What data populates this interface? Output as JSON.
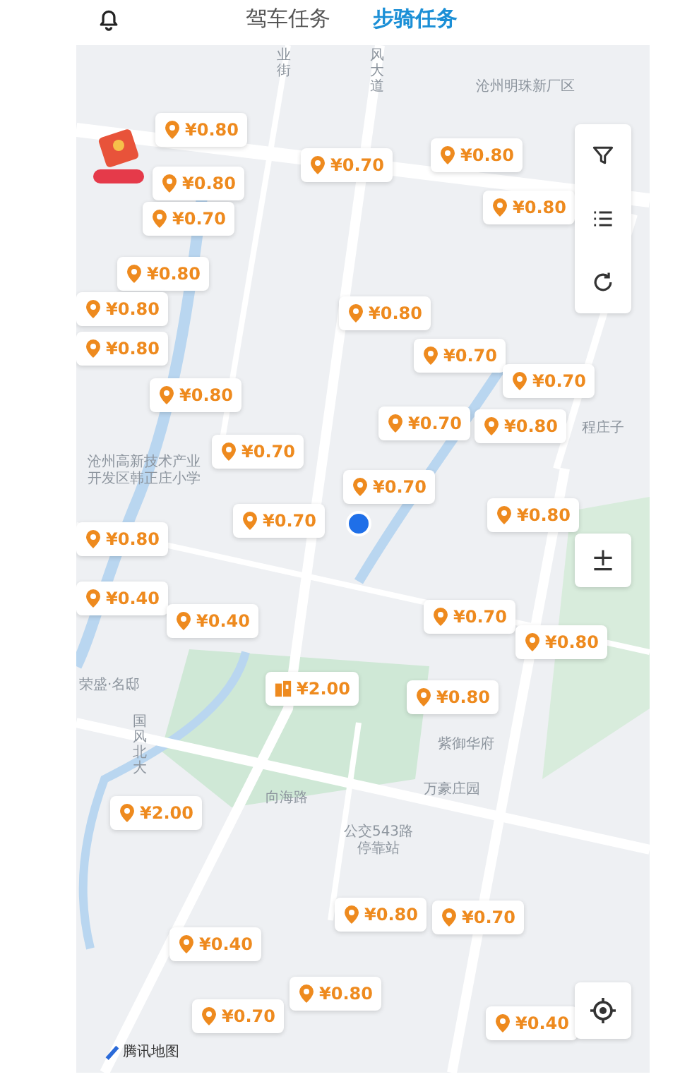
{
  "header": {
    "tabs": [
      {
        "label": "驾车任务",
        "selected": false
      },
      {
        "label": "步骑任务",
        "selected": true
      }
    ]
  },
  "map": {
    "labels": [
      {
        "text": "业街",
        "kind": "vertical"
      },
      {
        "text": "风大道",
        "kind": "vertical"
      },
      {
        "text": "沧州明珠新厂区",
        "kind": "place"
      },
      {
        "text": "沧州高新技术产业开发区韩正庄小学",
        "kind": "place"
      },
      {
        "text": "程庄子",
        "kind": "place"
      },
      {
        "text": "荣盛·名邸",
        "kind": "place"
      },
      {
        "text": "国风北大",
        "kind": "vertical"
      },
      {
        "text": "向海路",
        "kind": "road"
      },
      {
        "text": "紫御华府",
        "kind": "place"
      },
      {
        "text": "万豪庄园",
        "kind": "place"
      },
      {
        "text": "公交543路停靠站",
        "kind": "stop"
      }
    ],
    "markers": [
      {
        "price": "¥0.80",
        "kind": "pin"
      },
      {
        "price": "¥0.70",
        "kind": "pin"
      },
      {
        "price": "¥0.80",
        "kind": "pin"
      },
      {
        "price": "¥0.80",
        "kind": "pin"
      },
      {
        "price": "¥0.80",
        "kind": "pin"
      },
      {
        "price": "¥0.70",
        "kind": "pin"
      },
      {
        "price": "¥0.80",
        "kind": "pin"
      },
      {
        "price": "¥0.80",
        "kind": "pin"
      },
      {
        "price": "¥0.80",
        "kind": "pin"
      },
      {
        "price": "¥0.80",
        "kind": "pin"
      },
      {
        "price": "¥0.70",
        "kind": "pin"
      },
      {
        "price": "¥0.70",
        "kind": "pin"
      },
      {
        "price": "¥0.80",
        "kind": "pin"
      },
      {
        "price": "¥0.70",
        "kind": "pin"
      },
      {
        "price": "¥0.80",
        "kind": "pin"
      },
      {
        "price": "¥0.70",
        "kind": "pin"
      },
      {
        "price": "¥0.70",
        "kind": "pin"
      },
      {
        "price": "¥0.70",
        "kind": "pin"
      },
      {
        "price": "¥0.80",
        "kind": "pin"
      },
      {
        "price": "¥0.80",
        "kind": "pin"
      },
      {
        "price": "¥0.40",
        "kind": "pin"
      },
      {
        "price": "¥0.40",
        "kind": "pin"
      },
      {
        "price": "¥0.70",
        "kind": "pin"
      },
      {
        "price": "¥0.80",
        "kind": "pin"
      },
      {
        "price": "¥2.00",
        "kind": "package"
      },
      {
        "price": "¥0.80",
        "kind": "pin"
      },
      {
        "price": "¥2.00",
        "kind": "pin"
      },
      {
        "price": "¥0.80",
        "kind": "pin"
      },
      {
        "price": "¥0.70",
        "kind": "pin"
      },
      {
        "price": "¥0.40",
        "kind": "pin"
      },
      {
        "price": "¥0.80",
        "kind": "pin"
      },
      {
        "price": "¥0.70",
        "kind": "pin"
      },
      {
        "price": "¥0.40",
        "kind": "pin"
      }
    ],
    "attribution": "腾讯地图"
  }
}
